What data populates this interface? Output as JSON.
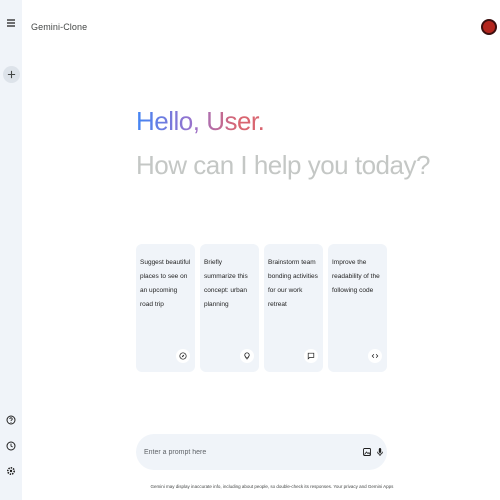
{
  "app": {
    "title": "Gemini-Clone"
  },
  "sidebar": {
    "menu_icon": "menu-icon",
    "new_chat_icon": "plus-icon",
    "bottom_icons": [
      "help-icon",
      "history-icon",
      "settings-icon"
    ]
  },
  "header": {
    "avatar_color": "#b3261e"
  },
  "main": {
    "greeting": "Hello, User.",
    "subgreeting": "How can I help you today?",
    "cards": [
      {
        "text": "Suggest beautiful places to see on an upcoming road trip",
        "icon": "compass-icon"
      },
      {
        "text": "Briefly summarize this concept: urban planning",
        "icon": "lightbulb-icon"
      },
      {
        "text": "Brainstorm team bonding activities for our work retreat",
        "icon": "message-icon"
      },
      {
        "text": "Improve the readability of the following code",
        "icon": "code-icon"
      }
    ]
  },
  "prompt": {
    "placeholder": "Enter a prompt here",
    "icons": [
      "gallery-icon",
      "mic-icon"
    ]
  },
  "footer": {
    "disclaimer": "Gemini may display inaccurate info, including about people, so double-check its responses. Your privacy and Gemini Apps"
  },
  "colors": {
    "rail_bg": "#f0f4f9",
    "card_bg": "#f0f4f9",
    "gradient": [
      "#4285f4",
      "#9b72cb",
      "#d96570"
    ],
    "subgreeting": "#c4c7c5"
  }
}
